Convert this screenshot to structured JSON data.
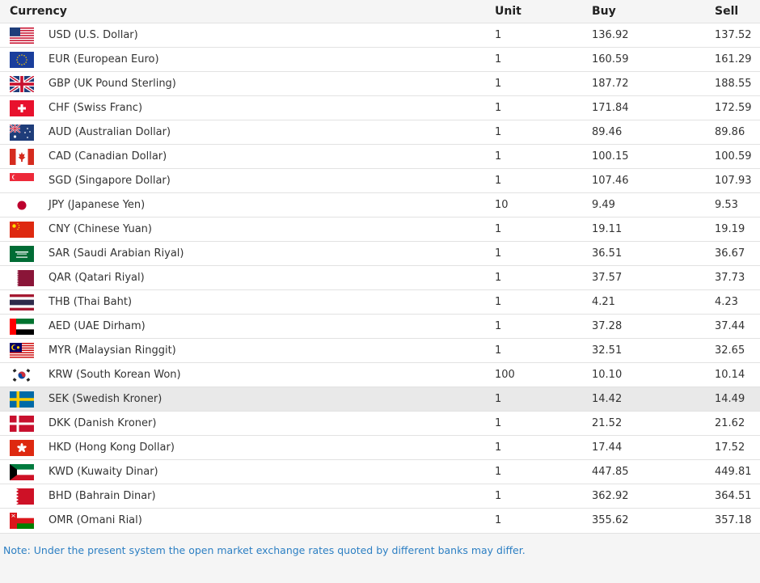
{
  "table": {
    "headers": {
      "currency": "Currency",
      "unit": "Unit",
      "buy": "Buy",
      "sell": "Sell"
    },
    "rows": [
      {
        "flag": "usa-flag-icon",
        "name": "USD (U.S. Dollar)",
        "unit": "1",
        "buy": "136.92",
        "sell": "137.52"
      },
      {
        "flag": "eu-flag-icon",
        "name": "EUR (European Euro)",
        "unit": "1",
        "buy": "160.59",
        "sell": "161.29"
      },
      {
        "flag": "uk-flag-icon",
        "name": "GBP (UK Pound Sterling)",
        "unit": "1",
        "buy": "187.72",
        "sell": "188.55"
      },
      {
        "flag": "switzerland-flag-icon",
        "name": "CHF (Swiss Franc)",
        "unit": "1",
        "buy": "171.84",
        "sell": "172.59"
      },
      {
        "flag": "australia-flag-icon",
        "name": "AUD (Australian Dollar)",
        "unit": "1",
        "buy": "89.46",
        "sell": "89.86"
      },
      {
        "flag": "canada-flag-icon",
        "name": "CAD (Canadian Dollar)",
        "unit": "1",
        "buy": "100.15",
        "sell": "100.59"
      },
      {
        "flag": "singapore-flag-icon",
        "name": "SGD (Singapore Dollar)",
        "unit": "1",
        "buy": "107.46",
        "sell": "107.93"
      },
      {
        "flag": "japan-flag-icon",
        "name": "JPY (Japanese Yen)",
        "unit": "10",
        "buy": "9.49",
        "sell": "9.53"
      },
      {
        "flag": "china-flag-icon",
        "name": "CNY (Chinese Yuan)",
        "unit": "1",
        "buy": "19.11",
        "sell": "19.19"
      },
      {
        "flag": "saudi-arabia-flag-icon",
        "name": "SAR (Saudi Arabian Riyal)",
        "unit": "1",
        "buy": "36.51",
        "sell": "36.67"
      },
      {
        "flag": "qatar-flag-icon",
        "name": "QAR (Qatari Riyal)",
        "unit": "1",
        "buy": "37.57",
        "sell": "37.73"
      },
      {
        "flag": "thailand-flag-icon",
        "name": "THB (Thai Baht)",
        "unit": "1",
        "buy": "4.21",
        "sell": "4.23"
      },
      {
        "flag": "uae-flag-icon",
        "name": "AED (UAE Dirham)",
        "unit": "1",
        "buy": "37.28",
        "sell": "37.44"
      },
      {
        "flag": "malaysia-flag-icon",
        "name": "MYR (Malaysian Ringgit)",
        "unit": "1",
        "buy": "32.51",
        "sell": "32.65"
      },
      {
        "flag": "south-korea-flag-icon",
        "name": "KRW (South Korean Won)",
        "unit": "100",
        "buy": "10.10",
        "sell": "10.14"
      },
      {
        "flag": "sweden-flag-icon",
        "name": "SEK (Swedish Kroner)",
        "unit": "1",
        "buy": "14.42",
        "sell": "14.49",
        "highlighted": true
      },
      {
        "flag": "denmark-flag-icon",
        "name": "DKK (Danish Kroner)",
        "unit": "1",
        "buy": "21.52",
        "sell": "21.62"
      },
      {
        "flag": "hong-kong-flag-icon",
        "name": "HKD (Hong Kong Dollar)",
        "unit": "1",
        "buy": "17.44",
        "sell": "17.52"
      },
      {
        "flag": "kuwait-flag-icon",
        "name": "KWD (Kuwaity Dinar)",
        "unit": "1",
        "buy": "447.85",
        "sell": "449.81"
      },
      {
        "flag": "bahrain-flag-icon",
        "name": "BHD (Bahrain Dinar)",
        "unit": "1",
        "buy": "362.92",
        "sell": "364.51"
      },
      {
        "flag": "oman-flag-icon",
        "name": "OMR (Omani Rial)",
        "unit": "1",
        "buy": "355.62",
        "sell": "357.18"
      }
    ]
  },
  "note": "Note: Under the present system the open market exchange rates quoted by different banks may differ.",
  "colors": {
    "note_text": "#2c7fc3",
    "row_highlight": "#e9e9e9",
    "border": "#e2e2e2"
  }
}
